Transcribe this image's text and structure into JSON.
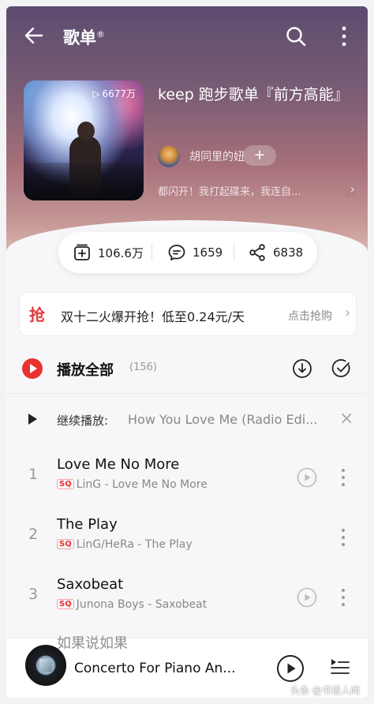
{
  "header": {
    "title": "歌单",
    "title_mark": "®"
  },
  "playlist": {
    "play_count": "6677万",
    "name": "keep 跑步歌单『前方高能』",
    "creator": "胡同里的妞",
    "follow": "+",
    "description": "都闪开！我打起碟来，我连自...",
    "desc_arrow": "›"
  },
  "stats": {
    "collect": "106.6万",
    "comments": "1659",
    "shares": "6838"
  },
  "promo": {
    "icon": "抢",
    "text": "双十二火爆开抢！低至0.24元/天",
    "cta": "点击抢购",
    "arrow": "›"
  },
  "play_all": {
    "label": "播放全部",
    "count": "(156)"
  },
  "continue": {
    "label": "继续播放:",
    "song": "How You Love Me (Radio Edi..."
  },
  "songs": [
    {
      "index": "1",
      "title": "Love Me No More",
      "quality": "SQ",
      "subtitle": "LinG - Love Me No More",
      "has_mv": true
    },
    {
      "index": "2",
      "title": "The Play",
      "quality": "SQ",
      "subtitle": "LinG/HeRa - The Play",
      "has_mv": false
    },
    {
      "index": "3",
      "title": "Saxobeat",
      "quality": "SQ",
      "subtitle": "Junona Boys - Saxobeat",
      "has_mv": true
    }
  ],
  "peek_song": "如果说如果",
  "now_playing": {
    "title": "Concerto For Piano An..."
  },
  "watermark": "头条 @书语人间",
  "icons": {
    "back": "arrow-left-icon",
    "search": "search-icon",
    "more": "more-vertical-icon",
    "collect": "add-to-collection-icon",
    "comment": "comment-icon",
    "share": "share-icon",
    "download": "download-icon",
    "multi_select": "check-circle-icon",
    "mv": "video-play-icon",
    "playlist": "playlist-icon"
  },
  "colors": {
    "accent": "#e8322f",
    "header_top": "#5c4c70",
    "header_bottom": "#d9b6b4"
  }
}
